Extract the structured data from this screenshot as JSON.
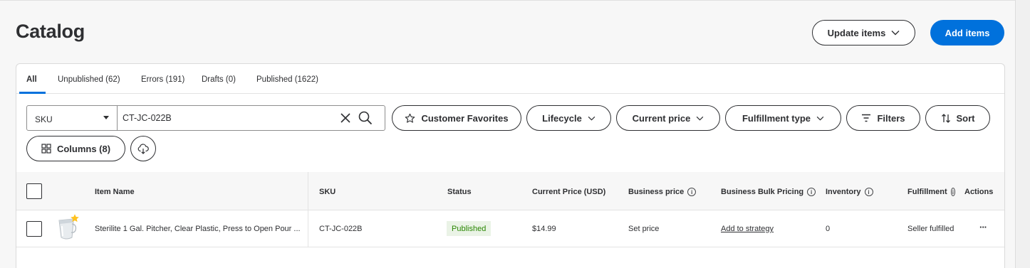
{
  "header": {
    "title": "Catalog",
    "update_items_label": "Update items",
    "add_items_label": "Add items"
  },
  "tabs": [
    {
      "label": "All",
      "active": true
    },
    {
      "label": "Unpublished (62)"
    },
    {
      "label": "Errors (191)"
    },
    {
      "label": "Drafts (0)"
    },
    {
      "label": "Published (1622)"
    }
  ],
  "search": {
    "field_select": "SKU",
    "value": "CT-JC-022B"
  },
  "filters": {
    "customer_favorites": "Customer Favorites",
    "lifecycle": "Lifecycle",
    "current_price": "Current price",
    "fulfillment_type": "Fulfillment type",
    "filters": "Filters",
    "sort": "Sort",
    "columns": "Columns (8)"
  },
  "table": {
    "headers": {
      "item_name": "Item Name",
      "sku": "SKU",
      "status": "Status",
      "current_price": "Current Price (USD)",
      "business_price": "Business price",
      "business_bulk_pricing": "Business Bulk Pricing",
      "inventory": "Inventory",
      "fulfillment": "Fulfillment",
      "actions": "Actions"
    },
    "rows": [
      {
        "item_name": "Sterilite 1 Gal. Pitcher, Clear Plastic, Press to Open Pour ...",
        "sku": "CT-JC-022B",
        "status": "Published",
        "current_price": "$14.99",
        "business_price": "Set price",
        "business_bulk_pricing": "Add to strategy",
        "inventory": "0",
        "fulfillment": "Seller fulfilled",
        "actions": "···"
      }
    ]
  },
  "colors": {
    "primary": "#0071dc",
    "status_published_bg": "#eaf3e6",
    "status_published_text": "#2a8703",
    "favorite_star": "#ffc220"
  }
}
